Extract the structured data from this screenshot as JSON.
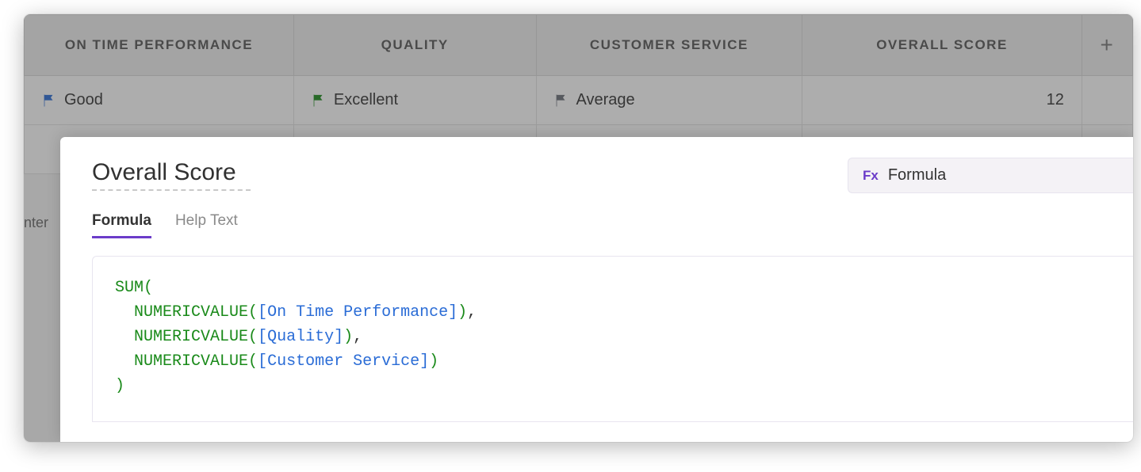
{
  "grid": {
    "columns": [
      "ON TIME PERFORMANCE",
      "QUALITY",
      "CUSTOMER SERVICE",
      "OVERALL SCORE"
    ],
    "add_column_glyph": "+",
    "row1": {
      "on_time": {
        "label": "Good",
        "flag_color": "#2a6cd6"
      },
      "quality": {
        "label": "Excellent",
        "flag_color": "#1a8a1a"
      },
      "customer": {
        "label": "Average",
        "flag_color": "#6a6f78"
      },
      "score": "12"
    },
    "truncated_left_label": "nter"
  },
  "panel": {
    "title": "Overall Score",
    "column_type": {
      "prefix": "Fx",
      "label": "Formula"
    },
    "tabs": {
      "formula": "Formula",
      "help": "Help Text",
      "active": "formula"
    },
    "formula_tokens": {
      "sum": "SUM",
      "open": "(",
      "close": ")",
      "numericvalue": "NUMERICVALUE",
      "ref_open": "[",
      "ref_close": "]",
      "comma": ",",
      "refs": {
        "on_time": "On Time Performance",
        "quality": "Quality",
        "customer": "Customer Service"
      }
    }
  },
  "colors": {
    "accent_purple": "#6b3cc9",
    "fn_green": "#1a8a1a",
    "ref_blue": "#2a6cd6"
  }
}
